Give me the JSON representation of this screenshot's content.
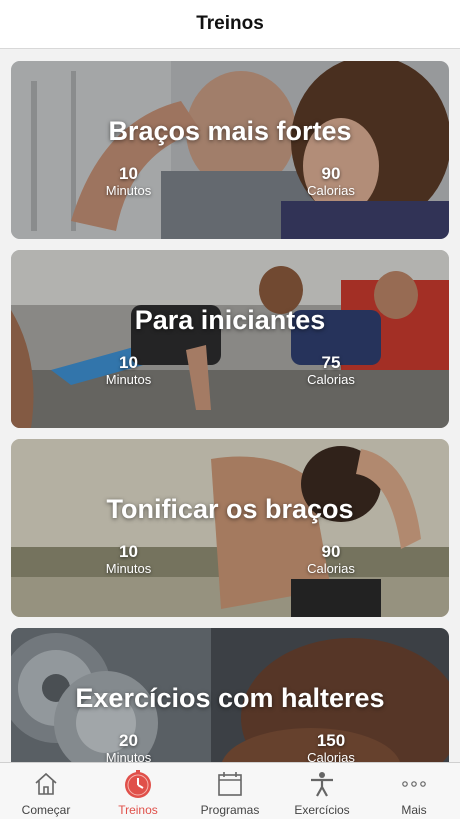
{
  "header": {
    "title": "Treinos"
  },
  "workouts": [
    {
      "title": "Braços mais fortes",
      "minutes": "10",
      "minutes_label": "Minutos",
      "calories": "90",
      "calories_label": "Calorias"
    },
    {
      "title": "Para iniciantes",
      "minutes": "10",
      "minutes_label": "Minutos",
      "calories": "75",
      "calories_label": "Calorias"
    },
    {
      "title": "Tonificar os braços",
      "minutes": "10",
      "minutes_label": "Minutos",
      "calories": "90",
      "calories_label": "Calorias"
    },
    {
      "title": "Exercícios com halteres",
      "minutes": "20",
      "minutes_label": "Minutos",
      "calories": "150",
      "calories_label": "Calorias"
    }
  ],
  "tabbar": {
    "active_color": "#e0504a",
    "items": [
      {
        "label": "Começar",
        "icon": "home-icon"
      },
      {
        "label": "Treinos",
        "icon": "stopwatch-icon",
        "active": true
      },
      {
        "label": "Programas",
        "icon": "calendar-icon"
      },
      {
        "label": "Exercícios",
        "icon": "person-icon"
      },
      {
        "label": "Mais",
        "icon": "more-dots-icon"
      }
    ]
  }
}
